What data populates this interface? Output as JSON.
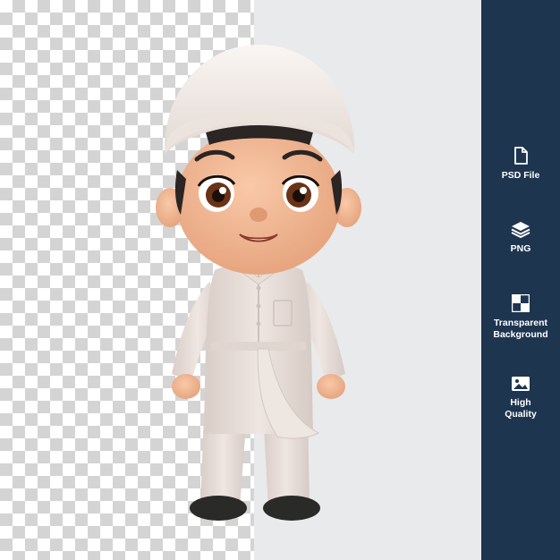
{
  "sidebar": {
    "items": [
      {
        "icon": "file-icon",
        "label": "PSD File"
      },
      {
        "icon": "layers-icon",
        "label": "PNG"
      },
      {
        "icon": "checkerboard-icon",
        "label": "Transparent\nBackground"
      },
      {
        "icon": "image-icon",
        "label": "High\nQuality"
      }
    ]
  },
  "colors": {
    "sidebar_bg": "#1e3550",
    "panel_bg": "#e9eaec",
    "checker_dark": "#d4d4d4",
    "outfit": "#e7dcd6",
    "skin": "#f2b896",
    "shoes": "#2a2a28"
  }
}
